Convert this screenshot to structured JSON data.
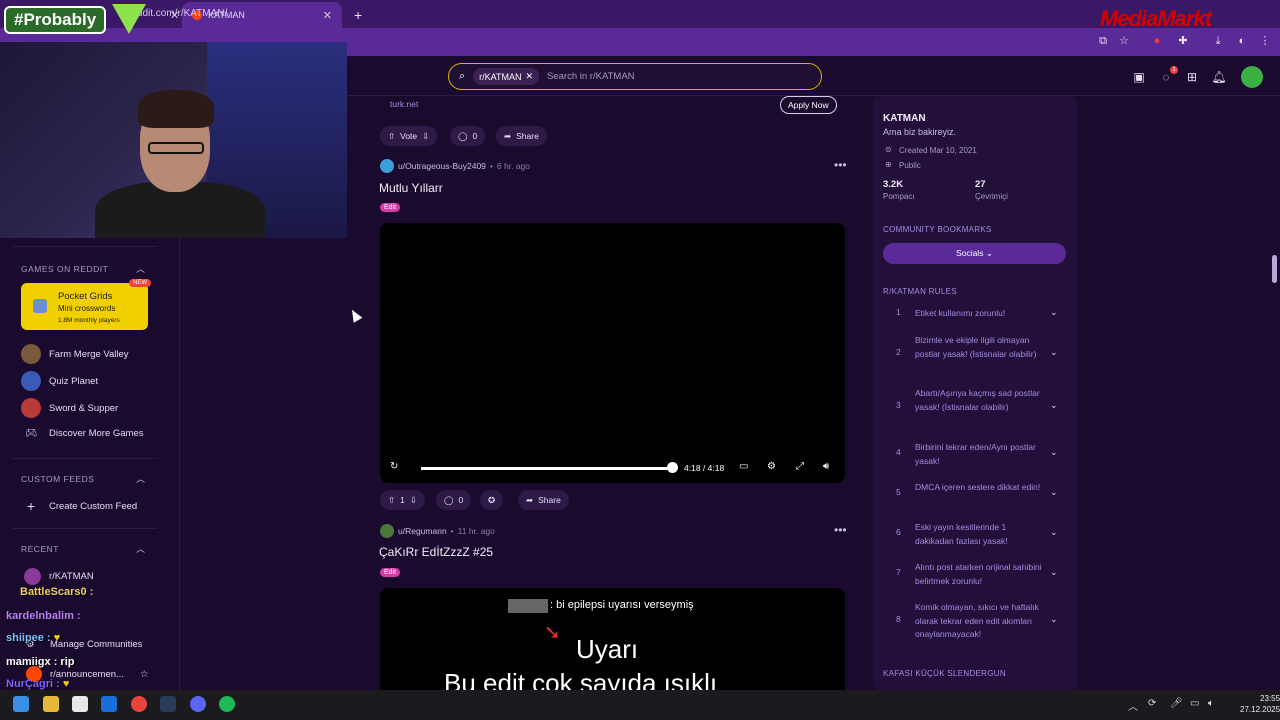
{
  "browser": {
    "tab_active": "KATMAN",
    "url": "reddit.com/r/KATMAN/"
  },
  "stream": {
    "brand": "#Probably",
    "sponsor": "MediaMarkt"
  },
  "search": {
    "chip": "r/KATMAN",
    "placeholder": "Search in r/KATMAN"
  },
  "header": {
    "notification_count": "1"
  },
  "left": {
    "games_title": "GAMES ON REDDIT",
    "game_card": {
      "title": "Pocket Grids",
      "subtitle": "Mini crosswords",
      "players": "1.8M monthly players",
      "badge": "NEW"
    },
    "games": [
      "Farm Merge Valley",
      "Quiz Planet",
      "Sword & Supper",
      "Discover More Games"
    ],
    "custom_feeds_title": "CUSTOM FEEDS",
    "create_feed": "Create Custom Feed",
    "recent_title": "RECENT",
    "recent_item": "r/KATMAN",
    "manage": "Manage Communities",
    "announcements": "r/announcemen..."
  },
  "ad": {
    "domain": "turk.net",
    "apply": "Apply Now",
    "vote": "Vote",
    "comments": "0",
    "share": "Share"
  },
  "post1": {
    "user": "u/Outrageous-Buy2409",
    "time": "6 hr. ago",
    "title": "Mutlu Yıllarr",
    "flair": "Edit",
    "video_time": "4:18 / 4:18",
    "votes": "1",
    "comments": "0",
    "share": "Share"
  },
  "post2": {
    "user": "u/Regumann",
    "time": "11 hr. ago",
    "title": "ÇaKıRr EdİtZzzZ #25",
    "flair": "Edit",
    "caption": ": bi epilepsi uyarısı verseymiş",
    "big1": "Uyarı",
    "big2": "Bu edit çok sayıda ışıklı"
  },
  "community": {
    "name": "KATMAN",
    "tagline": "Ama biz bakireyiz.",
    "created": "Created Mar 10, 2021",
    "visibility": "Public",
    "members": "3.2K",
    "members_label": "Pompacı",
    "online": "27",
    "online_label": "Çevrimiçi",
    "bookmarks_title": "COMMUNITY BOOKMARKS",
    "socials": "Socials",
    "rules_title": "R/KATMAN RULES",
    "rules": [
      {
        "n": "1",
        "text": "Etiket kullanımı zorunlu!"
      },
      {
        "n": "2",
        "text": "Bizimle ve ekiple ilgili olmayan postlar yasak! (İstisnalar olabilir)"
      },
      {
        "n": "3",
        "text": "Abartı/Aşırıya kaçmış sad postlar yasak! (İstisnalar olabilir)"
      },
      {
        "n": "4",
        "text": "Birbirini tekrar eden/Aynı postlar yasak!"
      },
      {
        "n": "5",
        "text": "DMCA içeren seslere dikkat edin!"
      },
      {
        "n": "6",
        "text": "Eski yayın kesitlerinde 1 dakikadan fazlası yasak!"
      },
      {
        "n": "7",
        "text": "Alıntı post atarken orijinal sahibini belirtmek zorunlu!"
      },
      {
        "n": "8",
        "text": "Komik olmayan, sıkıcı ve haftalık olarak tekrar eden edit akımları onaylanmayacak!"
      }
    ],
    "footer_head": "KAFASI KÜÇÜK SLENDERGUN"
  },
  "chat": [
    {
      "user": "BattleScars0",
      "msg": ""
    },
    {
      "user": "kardelnbalim",
      "msg": ""
    },
    {
      "user": "shiipee",
      "msg": ""
    },
    {
      "user": "mamiigx",
      "msg": "rip"
    },
    {
      "user": "NurÇagri",
      "msg": ""
    }
  ],
  "taskbar": {
    "time": "23:55",
    "date": "27.12.2025"
  }
}
